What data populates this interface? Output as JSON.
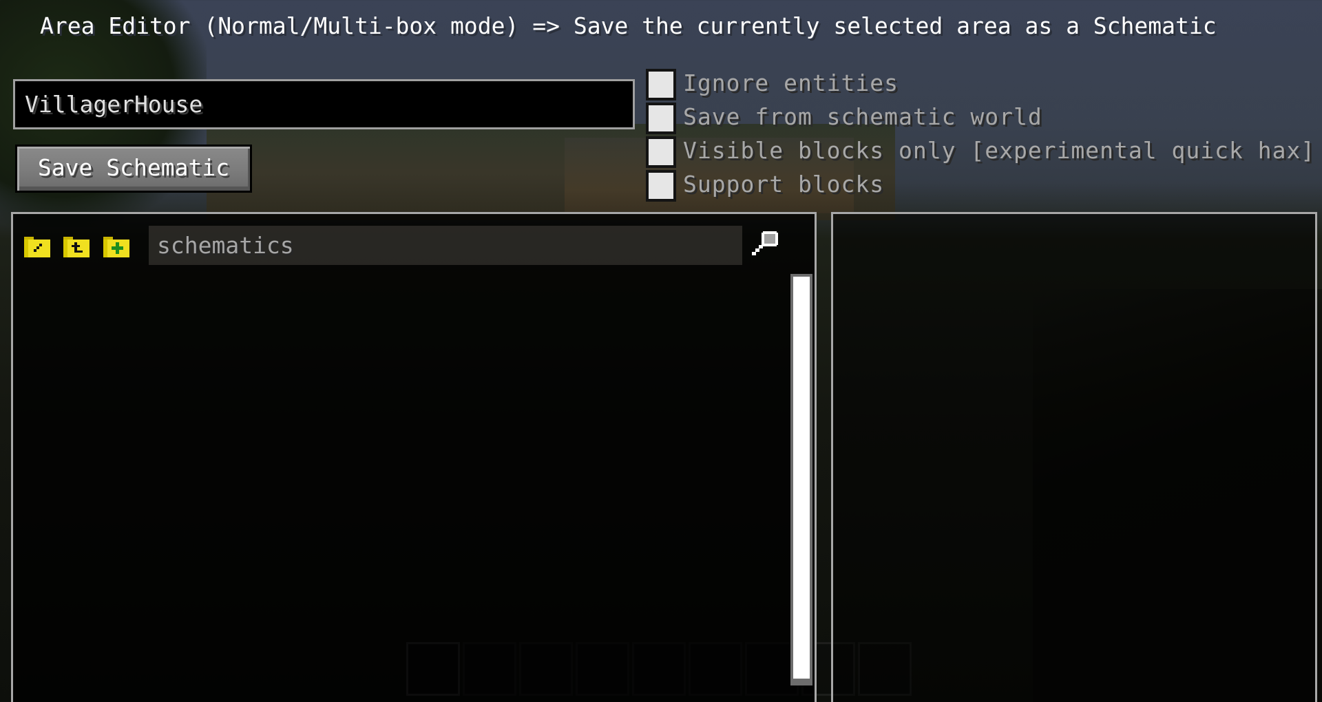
{
  "header": {
    "title": "Area Editor (Normal/Multi-box mode) => Save the currently selected area as a Schematic"
  },
  "save_form": {
    "name_field_value": "VillagerHouse",
    "save_button_label": "Save Schematic"
  },
  "options": [
    {
      "label": "Ignore entities",
      "checked": false
    },
    {
      "label": "Save from schematic world",
      "checked": false
    },
    {
      "label": "Visible blocks only [experimental quick hax]",
      "checked": false
    },
    {
      "label": "Support blocks",
      "checked": false
    }
  ],
  "browser": {
    "toolbar_icons": [
      {
        "name": "rename-folder-icon",
        "glyph": "pencil"
      },
      {
        "name": "parent-folder-icon",
        "glyph": "up-arrow"
      },
      {
        "name": "create-folder-icon",
        "glyph": "plus"
      }
    ],
    "current_directory": "schematics",
    "search_icon": "magnifier-icon",
    "entries": [],
    "scroll_fraction_visible": 0.99
  },
  "preview": {
    "content": ""
  },
  "hotbar": {
    "slot_count": 9,
    "selected_slot": 1
  },
  "colors": {
    "folder_yellow": "#f0e020",
    "folder_dark": "#c8b400",
    "plus_green": "#1e8c1e",
    "panel_border": "#a8a8a8",
    "option_text": "#a8a8a8",
    "title_text": "#ffffff"
  }
}
